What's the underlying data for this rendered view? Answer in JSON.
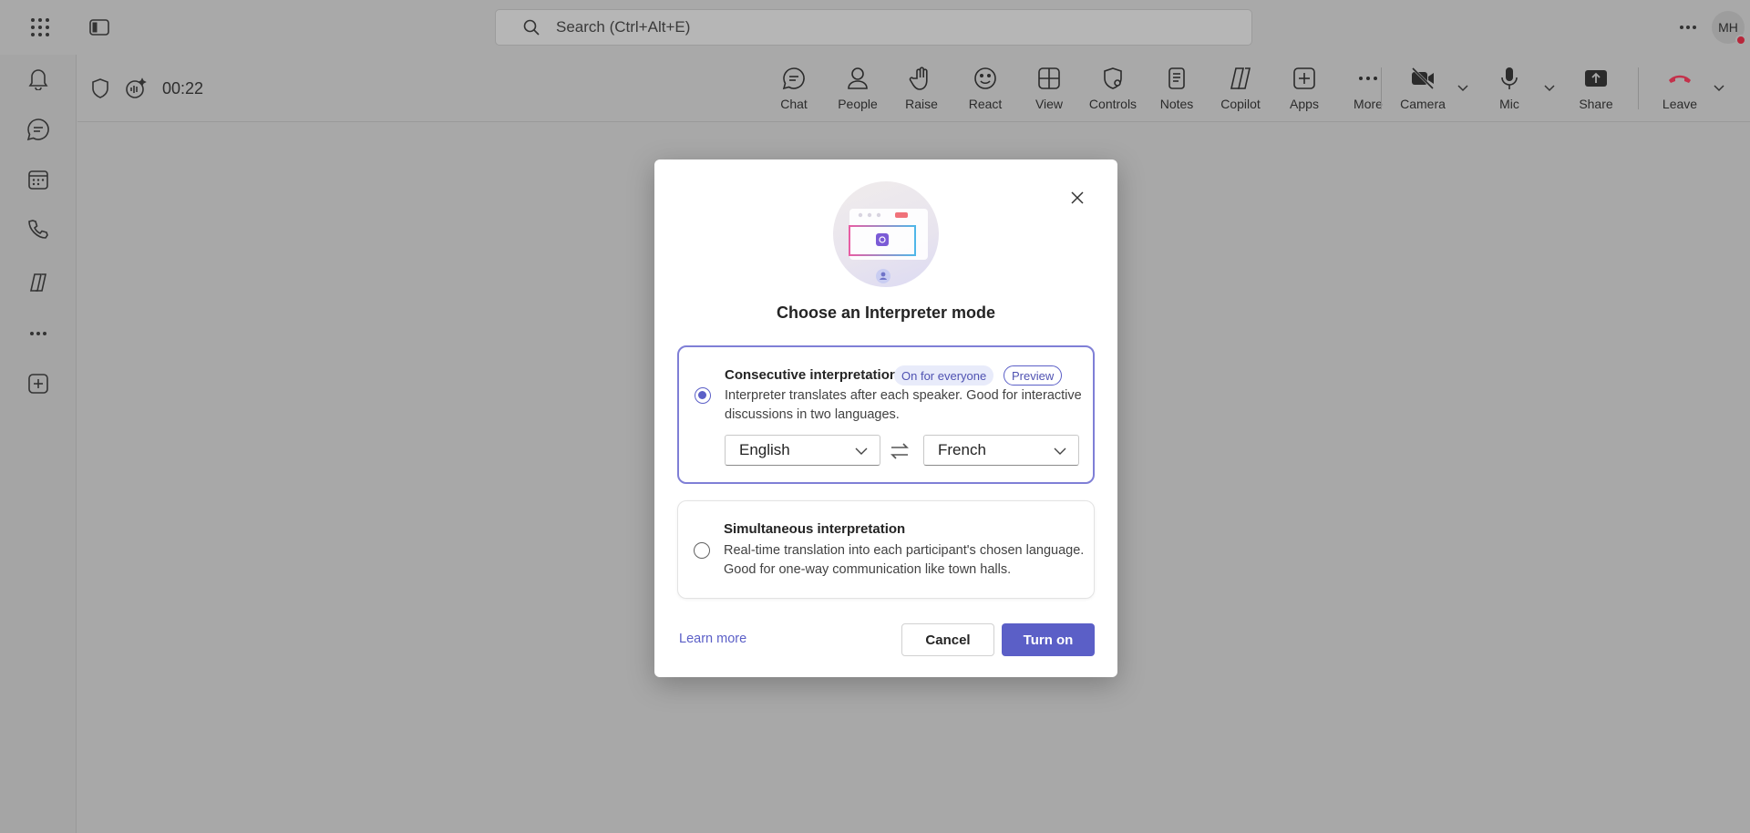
{
  "topbar": {
    "search_placeholder": "Search (Ctrl+Alt+E)",
    "avatar_initials": "MH"
  },
  "meeting": {
    "timer": "00:22",
    "tools": [
      {
        "label": "Chat",
        "icon": "chat-icon"
      },
      {
        "label": "People",
        "icon": "people-icon"
      },
      {
        "label": "Raise",
        "icon": "raise-hand-icon"
      },
      {
        "label": "React",
        "icon": "react-icon"
      },
      {
        "label": "View",
        "icon": "view-icon"
      },
      {
        "label": "Controls",
        "icon": "controls-icon"
      },
      {
        "label": "Notes",
        "icon": "notes-icon"
      },
      {
        "label": "Copilot",
        "icon": "copilot-icon"
      },
      {
        "label": "Apps",
        "icon": "apps-icon"
      },
      {
        "label": "More",
        "icon": "more-icon"
      },
      {
        "label": "Camera",
        "icon": "camera-off-icon"
      },
      {
        "label": "Mic",
        "icon": "mic-icon"
      },
      {
        "label": "Share",
        "icon": "share-icon"
      },
      {
        "label": "Leave",
        "icon": "leave-icon"
      }
    ]
  },
  "dialog": {
    "title": "Choose an Interpreter mode",
    "options": [
      {
        "title": "Consecutive interpretation",
        "badge_status": "On for everyone",
        "badge_preview": "Preview",
        "description": "Interpreter translates after each speaker. Good for interactive discussions in two languages.",
        "selected": true,
        "language_from": "English",
        "language_to": "French"
      },
      {
        "title": "Simultaneous interpretation",
        "description": "Real-time translation into each participant's chosen language. Good for one-way communication like town halls.",
        "selected": false
      }
    ],
    "learn_more": "Learn more",
    "cancel": "Cancel",
    "turn_on": "Turn on"
  },
  "colors": {
    "accent": "#5b5fc7",
    "overlay": "#a8a8a8",
    "leave": "#c4314b"
  }
}
